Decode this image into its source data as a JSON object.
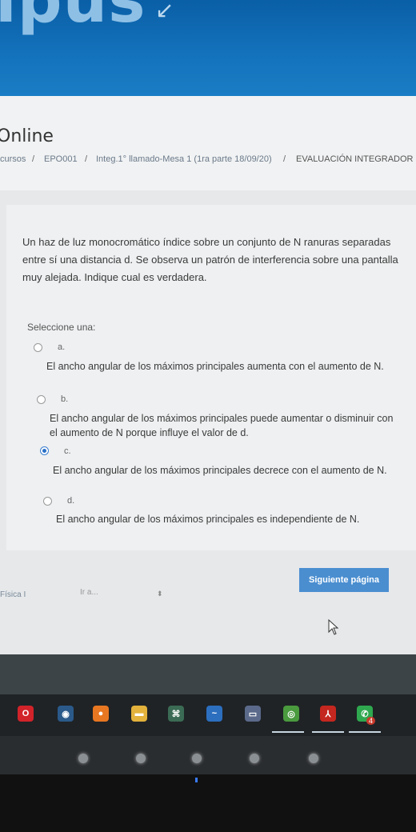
{
  "banner": {
    "logo_text": "ipus",
    "arrow_glyph": "↙"
  },
  "header": {
    "title": "Online",
    "breadcrumb": [
      {
        "label": "cursos"
      },
      {
        "label": "EPO001"
      },
      {
        "label": "Integ.1° llamado-Mesa 1 (1ra parte 18/09/20)"
      },
      {
        "label": "EVALUACIÓN INTEGRADOR"
      }
    ],
    "separator": "/"
  },
  "question": {
    "text": "Un haz de luz monocromático índice sobre un conjunto de N ranuras separadas entre sí una distancia d. Se observa un patrón de interferencia sobre una pantalla muy alejada. Indique cual es verdadera.",
    "prompt": "Seleccione una:",
    "options": [
      {
        "letter": "a.",
        "text": "El ancho angular de los máximos principales aumenta con el aumento de N.",
        "selected": false
      },
      {
        "letter": "b.",
        "text": "El ancho angular de los máximos principales puede aumentar o disminuir con el aumento de N porque influye el valor de d.",
        "selected": false
      },
      {
        "letter": "c.",
        "text": "El ancho angular de los máximos principales decrece con el aumento de N.",
        "selected": true
      },
      {
        "letter": "d.",
        "text": "El ancho angular de los máximos principales es independiente de N.",
        "selected": false
      }
    ]
  },
  "navigation": {
    "next_button": "Siguiente página",
    "course_link": "Física I",
    "jump_placeholder": "Ir a...",
    "jump_arrow": "⬍"
  },
  "taskbar": {
    "icons": [
      {
        "name": "opera-icon",
        "glyph": "O",
        "color": "#d2232a"
      },
      {
        "name": "app-icon",
        "glyph": "◉",
        "color": "#2b5a8a"
      },
      {
        "name": "media-icon",
        "glyph": "●",
        "color": "#e87722"
      },
      {
        "name": "folder-icon",
        "glyph": "▬",
        "color": "#e3b23c"
      },
      {
        "name": "calculator-icon",
        "glyph": "⌘",
        "color": "#3b6b54"
      },
      {
        "name": "edge-icon",
        "glyph": "~",
        "color": "#2c6fbf"
      },
      {
        "name": "storage-icon",
        "glyph": "▭",
        "color": "#5b6a8a"
      },
      {
        "name": "chrome-icon",
        "glyph": "◎",
        "color": "#4a9a3e"
      },
      {
        "name": "acrobat-icon",
        "glyph": "⅄",
        "color": "#c4271f"
      },
      {
        "name": "whatsapp-icon",
        "glyph": "✆",
        "color": "#2fa84f"
      }
    ],
    "badge": "4"
  }
}
